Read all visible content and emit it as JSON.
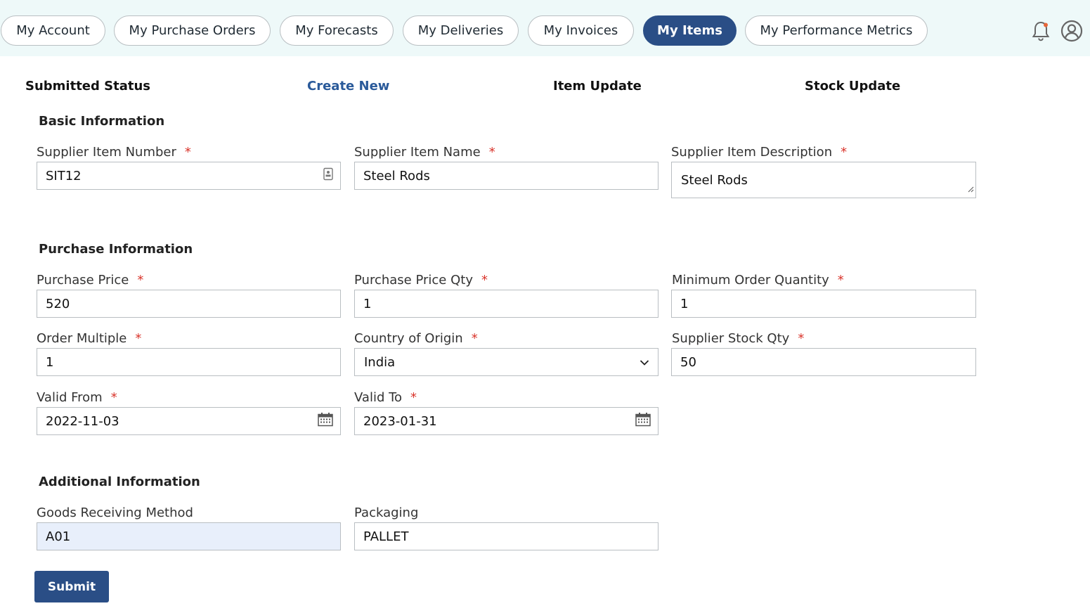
{
  "nav": {
    "tabs": [
      {
        "label": "My Account"
      },
      {
        "label": "My Purchase Orders"
      },
      {
        "label": "My Forecasts"
      },
      {
        "label": "My Deliveries"
      },
      {
        "label": "My Invoices"
      },
      {
        "label": "My Items"
      },
      {
        "label": "My Performance Metrics"
      }
    ],
    "active": "My Items",
    "icons": [
      "bell-icon",
      "user-profile-icon"
    ]
  },
  "subtabs": [
    {
      "label": "Submitted Status"
    },
    {
      "label": "Create New"
    },
    {
      "label": "Item Update"
    },
    {
      "label": "Stock Update"
    }
  ],
  "active_subtab": "Create New",
  "form": {
    "required_mark": "*",
    "basic": {
      "title": "Basic Information",
      "item_number": {
        "label": "Supplier Item Number",
        "value": "SIT12"
      },
      "item_name": {
        "label": "Supplier Item Name",
        "value": "Steel Rods"
      },
      "item_description": {
        "label": "Supplier Item Description",
        "value": "Steel Rods"
      }
    },
    "purchase": {
      "title": "Purchase Information",
      "purchase_price": {
        "label": "Purchase Price",
        "value": "520"
      },
      "purchase_price_qty": {
        "label": "Purchase Price Qty",
        "value": "1"
      },
      "min_order_qty": {
        "label": "Minimum Order Quantity",
        "value": "1"
      },
      "order_multiple": {
        "label": "Order Multiple",
        "value": "1"
      },
      "country_of_origin": {
        "label": "Country of Origin",
        "value": "India"
      },
      "supplier_stock_qty": {
        "label": "Supplier Stock Qty",
        "value": "50"
      },
      "valid_from": {
        "label": "Valid From",
        "value": "2022-11-03"
      },
      "valid_to": {
        "label": "Valid To",
        "value": "2023-01-31"
      }
    },
    "additional": {
      "title": "Additional Information",
      "goods_receiving_method": {
        "label": "Goods Receiving Method",
        "value": "A01"
      },
      "packaging": {
        "label": "Packaging",
        "value": "PALLET"
      }
    },
    "submit_label": "Submit"
  },
  "colors": {
    "brand": "#2a4e86",
    "topbar_bg": "#eef9f9",
    "required": "#d9342b",
    "readonly_field_bg": "#e8effb"
  }
}
